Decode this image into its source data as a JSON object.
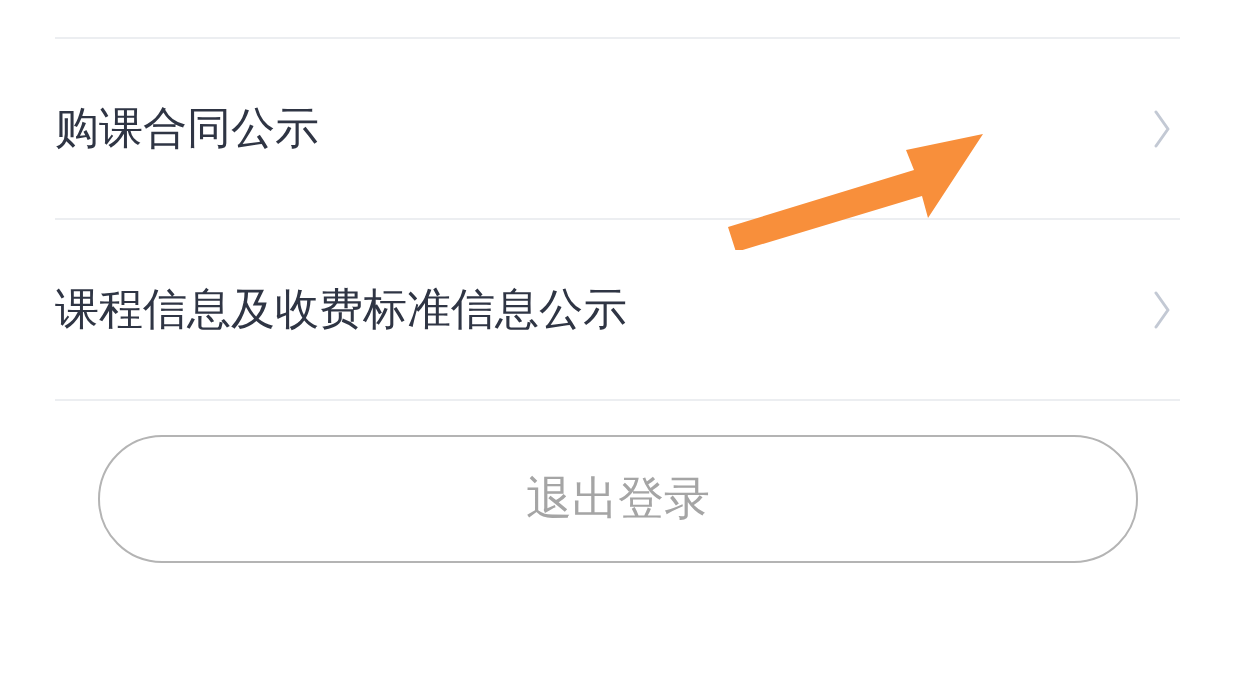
{
  "menu_items": [
    {
      "label": "购课合同公示"
    },
    {
      "label": "课程信息及收费标准信息公示"
    }
  ],
  "logout_button": {
    "label": "退出登录"
  }
}
